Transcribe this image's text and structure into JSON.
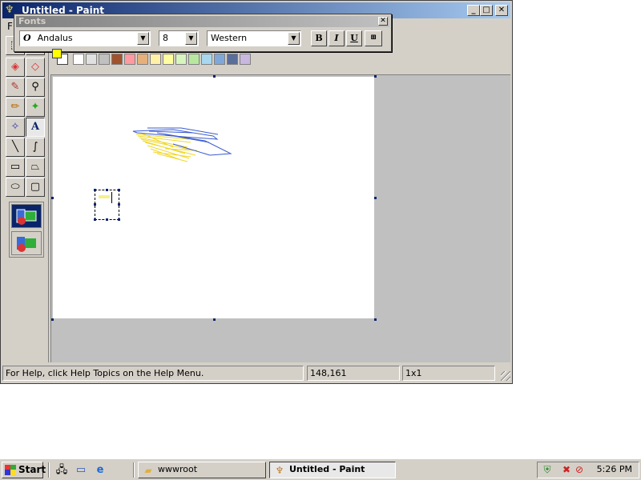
{
  "window": {
    "title": "Untitled - Paint",
    "menu_first": "F",
    "min_label": "_",
    "max_label": "□",
    "close_label": "✕"
  },
  "fonts_toolbar": {
    "title": "Fonts",
    "close_label": "✕",
    "font_name": "Andalus",
    "font_glyph": "O",
    "font_size": "8",
    "script": "Western",
    "bold_label": "B",
    "italic_label": "I",
    "underline_label": "U",
    "vertical_label": "⊞"
  },
  "tools": [
    {
      "name": "free-form-select",
      "icon": "⬚"
    },
    {
      "name": "select",
      "icon": "⬚"
    },
    {
      "name": "eraser",
      "icon": "◈"
    },
    {
      "name": "fill-with-color",
      "icon": "◇"
    },
    {
      "name": "pick-color",
      "icon": "✎"
    },
    {
      "name": "magnifier",
      "icon": "⚲"
    },
    {
      "name": "pencil",
      "icon": "✏"
    },
    {
      "name": "brush",
      "icon": "✦"
    },
    {
      "name": "airbrush",
      "icon": "✧"
    },
    {
      "name": "text",
      "icon": "A"
    },
    {
      "name": "line",
      "icon": "╲"
    },
    {
      "name": "curve",
      "icon": "∫"
    },
    {
      "name": "rectangle",
      "icon": "▭"
    },
    {
      "name": "polygon",
      "icon": "⏢"
    },
    {
      "name": "ellipse",
      "icon": "⬭"
    },
    {
      "name": "rounded-rectangle",
      "icon": "▢"
    }
  ],
  "active_tool": "text",
  "colors": {
    "foreground": "#ffff00",
    "background": "#ffffff",
    "palette": [
      "#ffffff",
      "#e0e0e0",
      "#c0c0c0",
      "#a0522d",
      "#ff9aa2",
      "#e6b07a",
      "#fff2a8",
      "#ffffa0",
      "#d8f5c0",
      "#b8e8a0",
      "#a8d8f0",
      "#7fa8d8",
      "#5a6e9a",
      "#c8b8e0"
    ]
  },
  "status": {
    "help_text": "For Help, click Help Topics on the Help Menu.",
    "coordinates": "148,161",
    "selection_size": "1x1"
  },
  "taskbar": {
    "start_label": "Start",
    "tasks": [
      {
        "label": "wwwroot",
        "active": false
      },
      {
        "label": "Untitled - Paint",
        "active": true
      }
    ],
    "clock": "5:26 PM"
  }
}
